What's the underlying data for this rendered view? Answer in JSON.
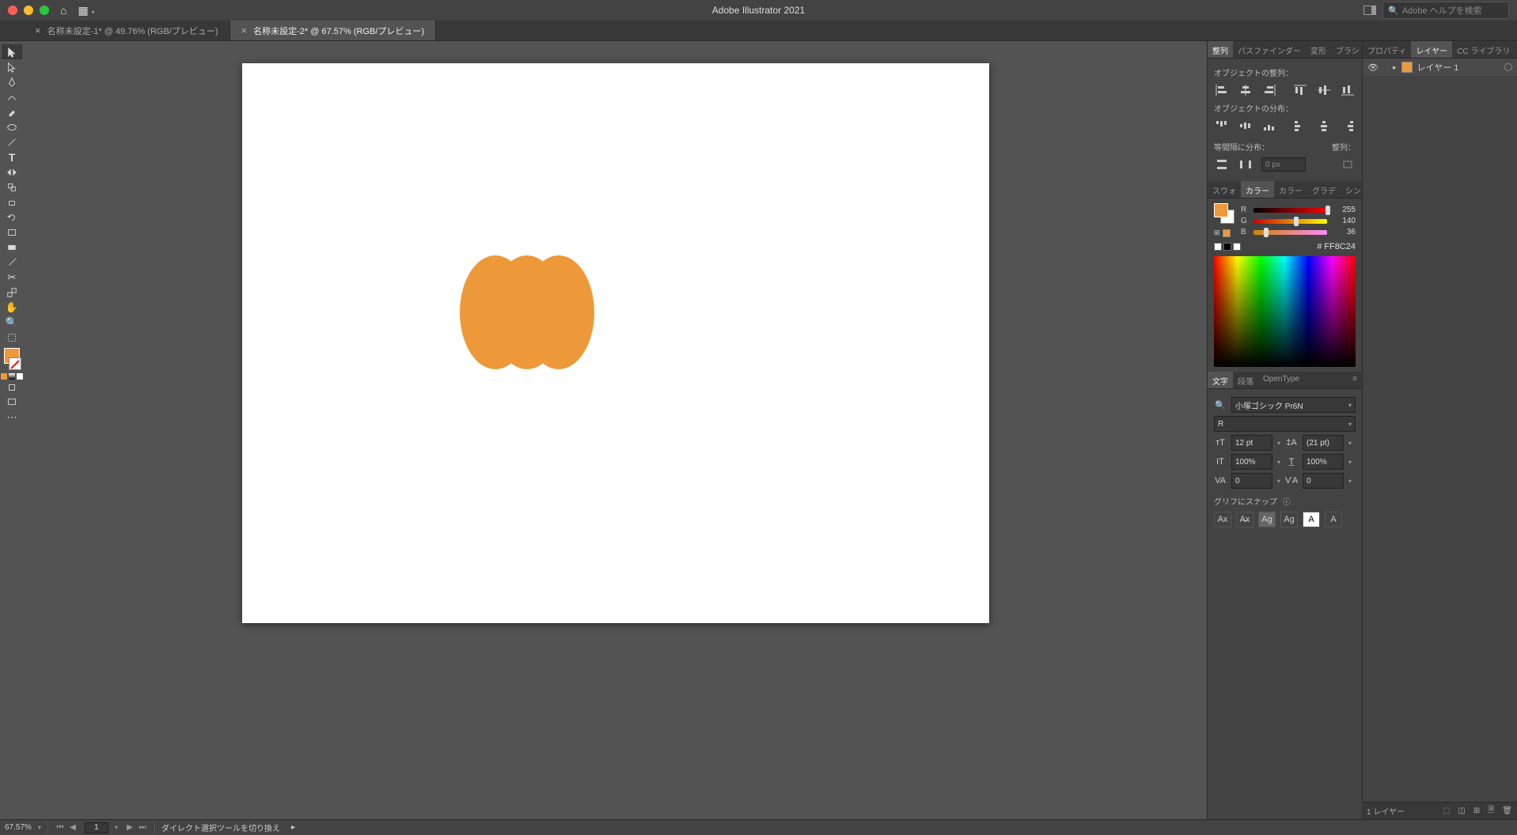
{
  "app": {
    "title": "Adobe Illustrator 2021",
    "search_placeholder": "Adobe ヘルプを検索"
  },
  "tabs": [
    {
      "label": "名称未設定-1* @ 49.76% (RGB/プレビュー)",
      "active": false
    },
    {
      "label": "名称未設定-2* @ 67.57% (RGB/プレビュー)",
      "active": true
    }
  ],
  "align_panel": {
    "tabs": [
      "整列",
      "パスファインダー",
      "変形",
      "ブラシ"
    ],
    "section1": "オブジェクトの整列：",
    "section2": "オブジェクトの分布：",
    "section3": "等間隔に分布：",
    "section3b": "整列：",
    "spacing_value": "0 px"
  },
  "color_panel": {
    "tabs": [
      "スウォ",
      "カラー",
      "カラー",
      "グラデ",
      "シンボ"
    ],
    "r": 255,
    "g": 140,
    "b": 36,
    "hex_prefix": "#",
    "hex": "FF8C24",
    "fill_color": "#ed993a"
  },
  "char_panel": {
    "tabs": [
      "文字",
      "段落",
      "OpenType"
    ],
    "font": "小塚ゴシック Pr6N",
    "style": "R",
    "size": "12 pt",
    "leading": "(21 pt)",
    "hscale": "100%",
    "vscale": "100%",
    "tracking": "0",
    "kerning": "0",
    "snap_label": "グリフにスナップ"
  },
  "layers_panel": {
    "tabs": [
      "プロパティ",
      "レイヤー",
      "CC ライブラリ"
    ],
    "layer1": "レイヤー 1",
    "footer_count": "1 レイヤー"
  },
  "status": {
    "zoom": "67.57%",
    "page": "1",
    "tool_hint": "ダイレクト選択ツールを切り換え"
  }
}
